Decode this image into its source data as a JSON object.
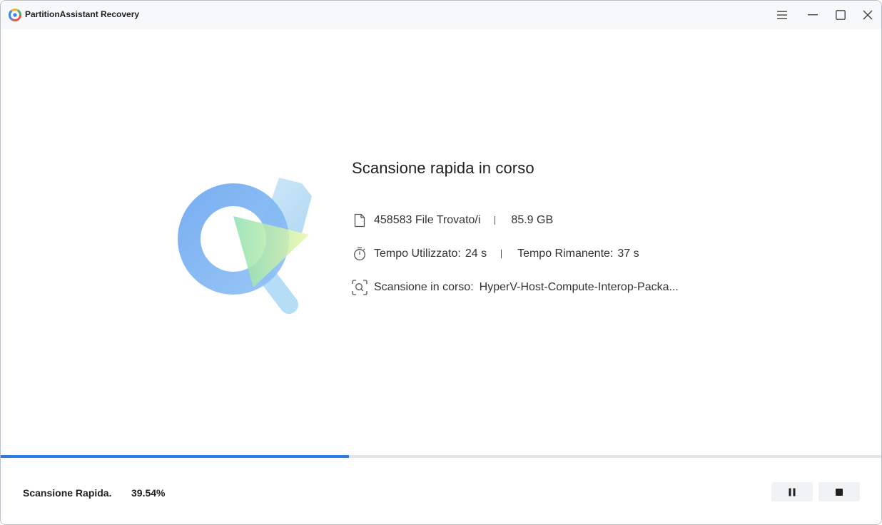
{
  "window": {
    "title": "PartitionAssistant Recovery"
  },
  "scan": {
    "heading": "Scansione rapida in corso",
    "files_found": "458583 File Trovato/i",
    "size": "85.9 GB",
    "time_used_label": "Tempo Utilizzato:",
    "time_used_value": "24 s",
    "time_remaining_label": "Tempo Rimanente:",
    "time_remaining_value": "37 s",
    "current_label": "Scansione in corso:",
    "current_item": "HyperV-Host-Compute-Interop-Packa..."
  },
  "progress": {
    "mode_label": "Scansione Rapida.",
    "percent_text": "39.54%",
    "percent": 39.54
  },
  "icons": {
    "menu": "hamburger-menu-icon",
    "minimize": "minimize-icon",
    "maximize": "maximize-icon",
    "close": "close-icon",
    "file": "file-icon",
    "timer": "timer-icon",
    "scan": "scan-icon",
    "pause": "pause-icon",
    "stop": "stop-icon"
  },
  "colors": {
    "accent": "#2c7be5",
    "track": "#e3e5e8",
    "button_bg": "#f1f2f4"
  }
}
